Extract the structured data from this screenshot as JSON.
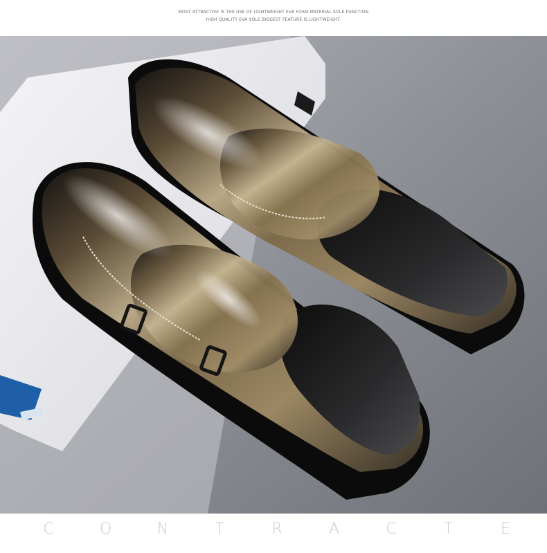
{
  "caption": {
    "line1": "MOST ATTRACTIVE IS THE USE OF LIGHTWEIGHT EVA FOAM MATERIAL SOLE FUNCTION",
    "line2": "HIGH QUALITY EVA SOLE BIGGEST FEATURE IS LIGHTWEIGHT."
  },
  "photo": {
    "subject": "pair-of-double-monk-strap-shoes",
    "colors": {
      "background": "#8f9297",
      "leather": "#8a7654",
      "leather_dark": "#1e1c1a",
      "tablet": "#e9e9ec"
    }
  },
  "footer": {
    "letters": [
      "C",
      "O",
      "N",
      "T",
      "R",
      "A",
      "C",
      "T",
      "E"
    ]
  }
}
